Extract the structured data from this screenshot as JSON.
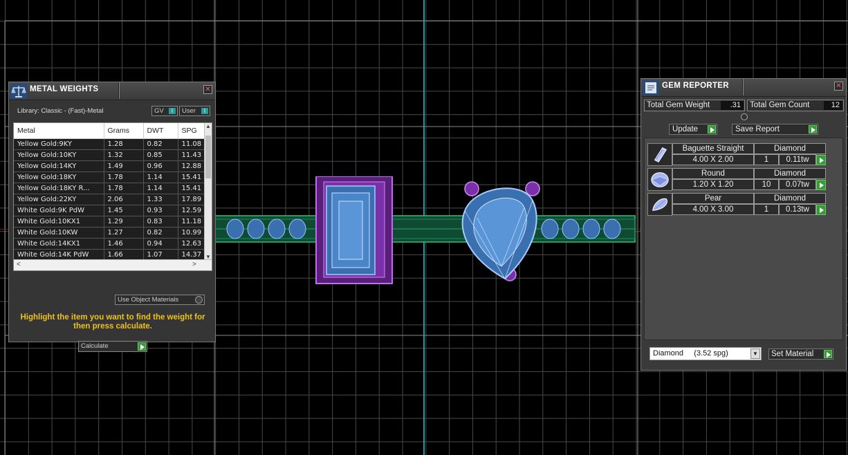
{
  "metal_weights": {
    "title": "METAL WEIGHTS",
    "library_label": "Library: Classic - (Fast)-Metal",
    "toggle_gv": "GV",
    "toggle_user": "User",
    "columns": [
      "Metal",
      "Grams",
      "DWT",
      "SPG"
    ],
    "rows": [
      [
        "Yellow Gold:9KY",
        "1.28",
        "0.82",
        "11.08"
      ],
      [
        "Yellow Gold:10KY",
        "1.32",
        "0.85",
        "11.43"
      ],
      [
        "Yellow Gold:14KY",
        "1.49",
        "0.96",
        "12.88"
      ],
      [
        "Yellow Gold:18KY",
        "1.78",
        "1.14",
        "15.41"
      ],
      [
        "Yellow Gold:18KY R...",
        "1.78",
        "1.14",
        "15.41"
      ],
      [
        "Yellow Gold:22KY",
        "2.06",
        "1.33",
        "17.89"
      ],
      [
        "White Gold:9K PdW",
        "1.45",
        "0.93",
        "12.59"
      ],
      [
        "White Gold:10KX1",
        "1.29",
        "0.83",
        "11.18"
      ],
      [
        "White Gold:10KW",
        "1.27",
        "0.82",
        "10.99"
      ],
      [
        "White Gold:14KX1",
        "1.46",
        "0.94",
        "12.63"
      ],
      [
        "White Gold:14K PdW",
        "1.66",
        "1.07",
        "14.37"
      ]
    ],
    "use_object_materials": "Use Object Materials",
    "hint": "Highlight the item you want to find the weight for then press calculate.",
    "calculate_label": "Calculate"
  },
  "gem_reporter": {
    "title": "GEM REPORTER",
    "total_weight_label": "Total Gem Weight",
    "total_weight_value": ".31",
    "total_count_label": "Total Gem Count",
    "total_count_value": "12",
    "update_label": "Update",
    "save_report_label": "Save Report",
    "gems": [
      {
        "shape": "Baguette Straight",
        "material": "Diamond",
        "size": "4.00 X 2.00",
        "count": "1",
        "weight": "0.11tw",
        "icon": "baguette-gem-icon"
      },
      {
        "shape": "Round",
        "material": "Diamond",
        "size": "1.20 X 1.20",
        "count": "10",
        "weight": "0.07tw",
        "icon": "round-gem-icon"
      },
      {
        "shape": "Pear",
        "material": "Diamond",
        "size": "4.00 X 3.00",
        "count": "1",
        "weight": "0.13tw",
        "icon": "pear-gem-icon"
      }
    ],
    "material_select": "Diamond     (3.52 spg)",
    "set_material_label": "Set Material"
  },
  "colors": {
    "shank": "#1e8a5a",
    "gem_wire": "#7fb0ff",
    "setting": "#9b3fc0",
    "axis_vertical": "#2a9a9a",
    "hint_text": "#f0c020"
  }
}
